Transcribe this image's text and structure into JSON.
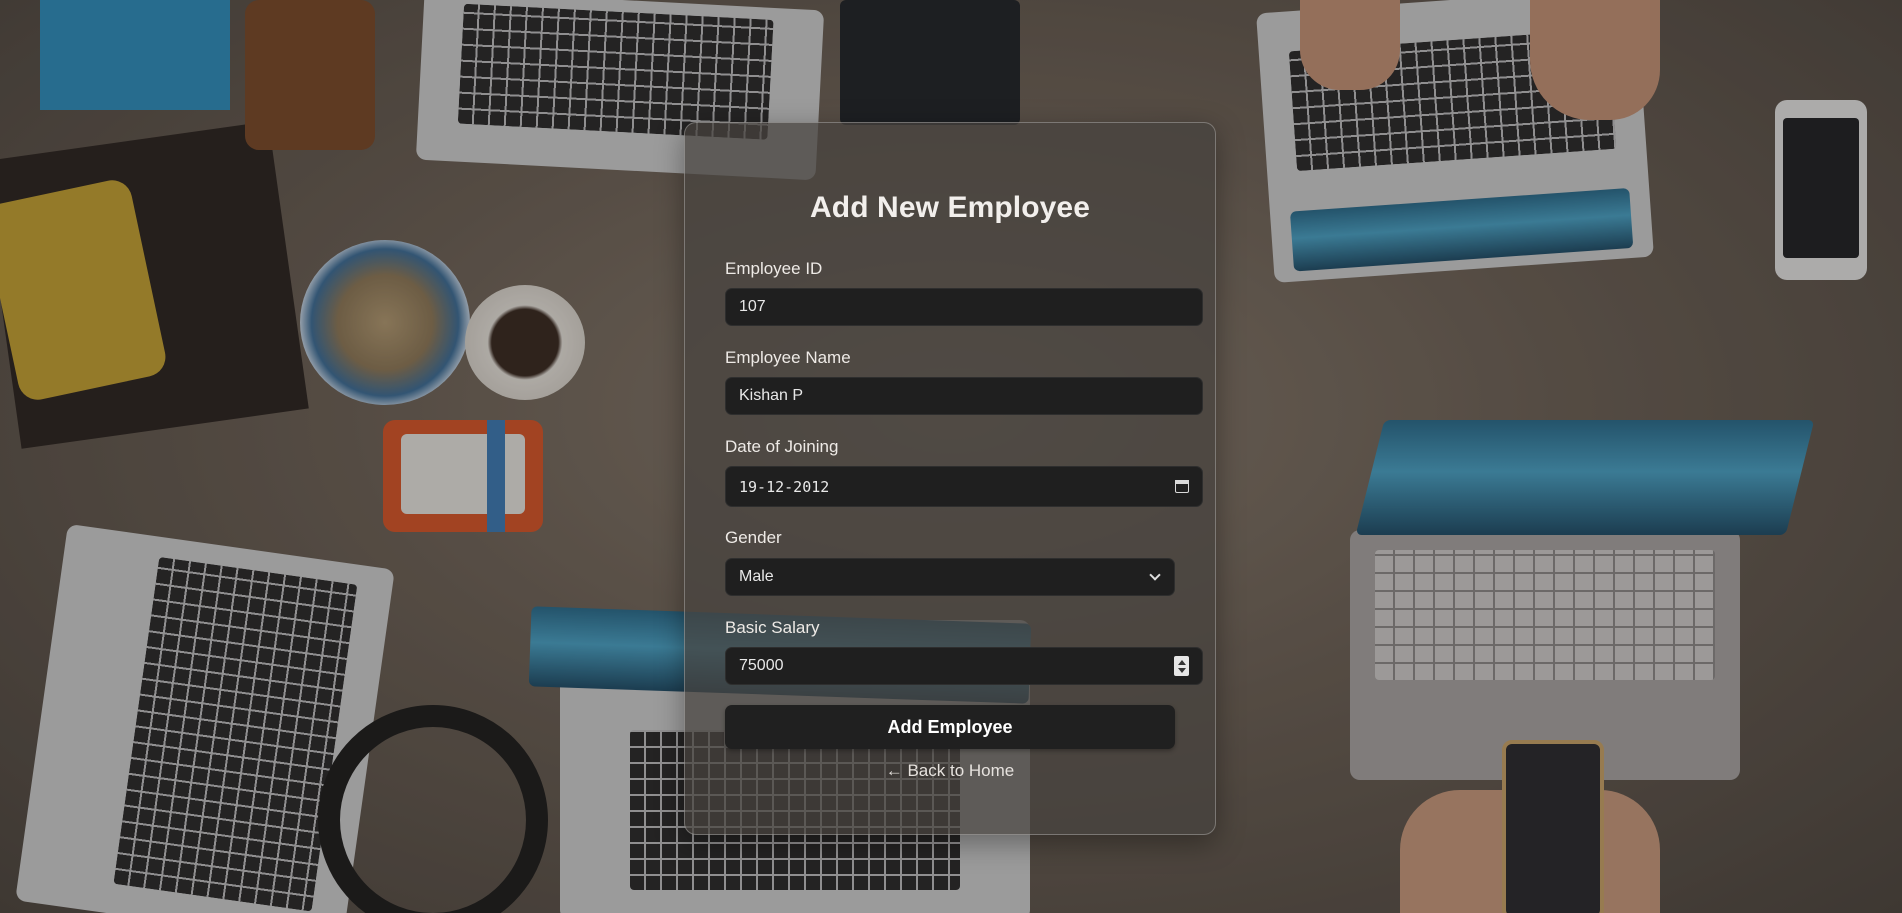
{
  "form": {
    "title": "Add New Employee",
    "fields": {
      "employee_id": {
        "label": "Employee ID",
        "value": "107"
      },
      "employee_name": {
        "label": "Employee Name",
        "value": "Kishan P"
      },
      "date_of_joining": {
        "label": "Date of Joining",
        "value": "19-12-2012"
      },
      "gender": {
        "label": "Gender",
        "value": "Male"
      },
      "basic_salary": {
        "label": "Basic Salary",
        "value": "75000"
      }
    },
    "submit_label": "Add Employee",
    "back_link": "← Back to Home"
  },
  "icons": {
    "date": "calendar-icon",
    "select": "chevron-down-icon",
    "number": "spinner-icon"
  }
}
